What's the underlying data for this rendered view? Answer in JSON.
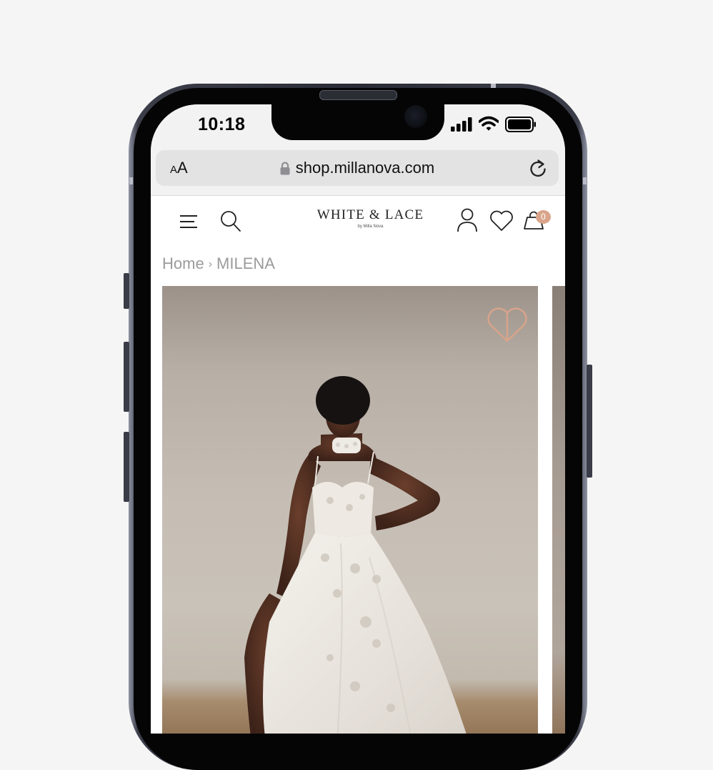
{
  "status_bar": {
    "time": "10:18"
  },
  "browser": {
    "text_size_small": "A",
    "text_size_large": "A",
    "url": "shop.millanova.com"
  },
  "site": {
    "logo": "WHITE & LACE",
    "logo_sub": "by Milla Nova",
    "cart_count": "0",
    "icons": [
      "menu-icon",
      "search-icon",
      "account-icon",
      "heart-icon",
      "shopping-bag-icon"
    ]
  },
  "breadcrumb": {
    "home": "Home",
    "separator": "›",
    "current": "MILENA"
  },
  "product": {
    "image_alt": "Bride in white lace ball gown"
  },
  "colors": {
    "accent": "#d9a48a",
    "wishlist_outline": "#d9a48a",
    "breadcrumb_text": "#9b9b9b"
  }
}
